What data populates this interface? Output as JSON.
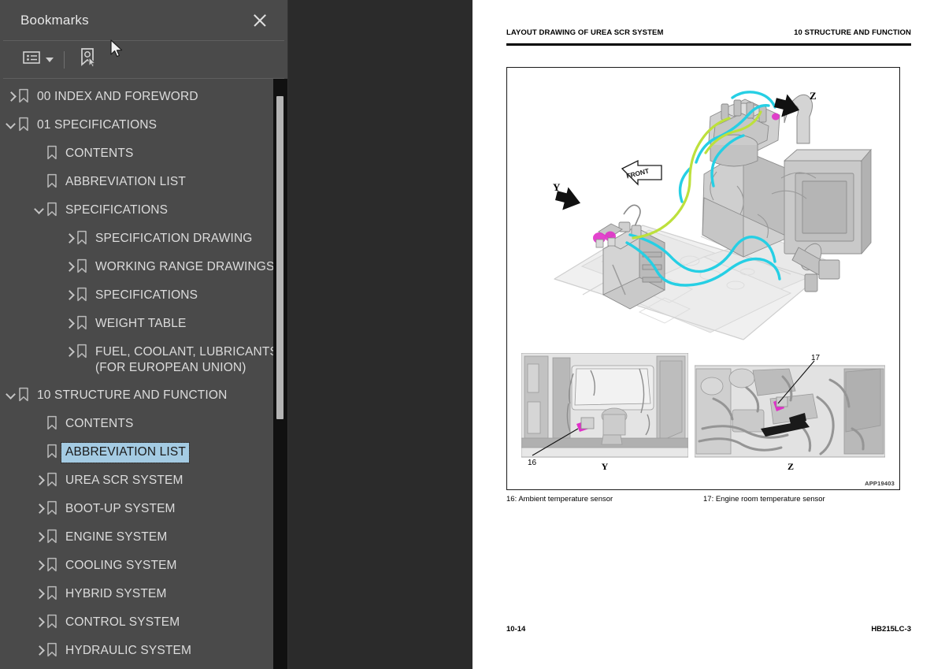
{
  "panel": {
    "title": "Bookmarks",
    "close_icon": "close-icon",
    "toolbar": {
      "options_icon": "list-options-icon",
      "new_bookmark_icon": "new-bookmark-icon"
    }
  },
  "tree": {
    "items": [
      {
        "label": "00 INDEX AND FOREWORD",
        "level": 0,
        "state": "collapsed",
        "selected": false
      },
      {
        "label": "01 SPECIFICATIONS",
        "level": 0,
        "state": "expanded",
        "selected": false
      },
      {
        "label": "CONTENTS",
        "level": 1,
        "state": "leaf",
        "selected": false
      },
      {
        "label": "ABBREVIATION LIST",
        "level": 1,
        "state": "leaf",
        "selected": false
      },
      {
        "label": "SPECIFICATIONS",
        "level": 1,
        "state": "expanded",
        "selected": false
      },
      {
        "label": "SPECIFICATION DRAWING",
        "level": 2,
        "state": "collapsed",
        "selected": false
      },
      {
        "label": "WORKING RANGE DRAWINGS",
        "level": 2,
        "state": "collapsed",
        "selected": false
      },
      {
        "label": "SPECIFICATIONS",
        "level": 2,
        "state": "collapsed",
        "selected": false
      },
      {
        "label": "WEIGHT TABLE",
        "level": 2,
        "state": "collapsed",
        "selected": false
      },
      {
        "label": "FUEL, COOLANT, LUBRICANTS\n(FOR EUROPEAN UNION)",
        "level": 2,
        "state": "collapsed",
        "selected": false
      },
      {
        "label": "10 STRUCTURE AND FUNCTION",
        "level": 0,
        "state": "expanded",
        "selected": false
      },
      {
        "label": "CONTENTS",
        "level": 1,
        "state": "leaf",
        "selected": false
      },
      {
        "label": "ABBREVIATION LIST",
        "level": 1,
        "state": "leaf",
        "selected": true
      },
      {
        "label": "UREA SCR SYSTEM",
        "level": 1,
        "state": "collapsed",
        "selected": false
      },
      {
        "label": "BOOT-UP SYSTEM",
        "level": 1,
        "state": "collapsed",
        "selected": false
      },
      {
        "label": "ENGINE SYSTEM",
        "level": 1,
        "state": "collapsed",
        "selected": false
      },
      {
        "label": "COOLING SYSTEM",
        "level": 1,
        "state": "collapsed",
        "selected": false
      },
      {
        "label": "HYBRID SYSTEM",
        "level": 1,
        "state": "collapsed",
        "selected": false
      },
      {
        "label": "CONTROL SYSTEM",
        "level": 1,
        "state": "collapsed",
        "selected": false
      },
      {
        "label": "HYDRAULIC SYSTEM",
        "level": 1,
        "state": "collapsed",
        "selected": false
      }
    ],
    "selection_color": "#a4cbe3"
  },
  "document": {
    "header_left": "LAYOUT DRAWING OF UREA SCR SYSTEM",
    "header_right": "10 STRUCTURE AND FUNCTION",
    "figure_id": "APP19403",
    "captions": [
      "16: Ambient temperature sensor",
      "17: Engine room temperature sensor"
    ],
    "footer_left": "10-14",
    "footer_right": "HB215LC-3",
    "figure": {
      "front_arrow_label": "FRONT",
      "view_arrow_y": "Y",
      "view_arrow_z": "Z",
      "detail_left_letter": "Y",
      "detail_right_letter": "Z",
      "callout_left": "16",
      "callout_right": "17",
      "hose_color_cyan": "#2fd4e8",
      "hose_color_green": "#b9e03a",
      "sensor_color_magenta": "#e832c8"
    }
  },
  "colors": {
    "panel_bg": "#4a4a4a",
    "viewer_bg": "#2b2b2b",
    "scrollbar_track": "#111111",
    "scrollbar_thumb": "#b4b4b4"
  }
}
